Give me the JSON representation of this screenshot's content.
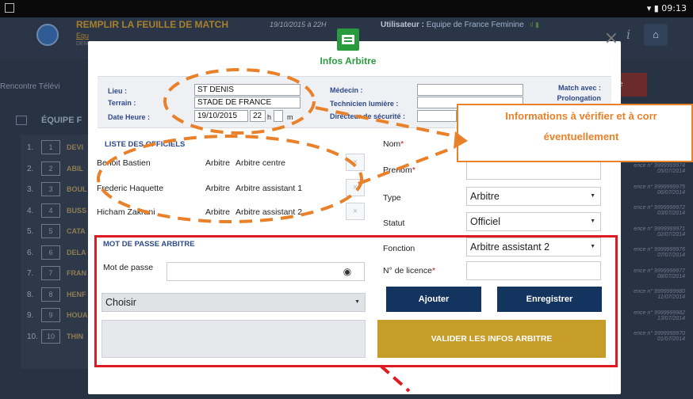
{
  "status_bar": {
    "time": "09:13"
  },
  "background_app": {
    "title": "REMPLIR LA FEUILLE DE MATCH",
    "sub1": "Equ",
    "sub2": "DEM",
    "date": "19/10/2015 à 22H",
    "user_label": "Utilisateur :",
    "user_value": "Equipe de France Feminine",
    "rencontre": "Rencontre Télévi",
    "red_button": "tre",
    "equipe_label": "ÉQUIPE F",
    "players": [
      {
        "n": "1.",
        "num": "1",
        "name": "DEVI"
      },
      {
        "n": "2.",
        "num": "2",
        "name": "ABIL"
      },
      {
        "n": "3.",
        "num": "3",
        "name": "BOUL"
      },
      {
        "n": "4.",
        "num": "4",
        "name": "BUSS"
      },
      {
        "n": "5.",
        "num": "5",
        "name": "CATA"
      },
      {
        "n": "6.",
        "num": "6",
        "name": "DELA"
      },
      {
        "n": "7.",
        "num": "7",
        "name": "FRAN"
      },
      {
        "n": "8.",
        "num": "8",
        "name": "HENF"
      },
      {
        "n": "9.",
        "num": "9",
        "name": "HOUA"
      },
      {
        "n": "10.",
        "num": "10",
        "name": "THIN"
      }
    ],
    "right_notes": [
      "ence n° 9999999974 05/07/2014",
      "ence n° 9999999975 06/07/2014",
      "ence n° 9999999972 03/07/2014",
      "ence n° 9999999971 02/07/2014",
      "ence n° 9999999976 07/07/2014",
      "ence n° 9999999977 08/07/2014",
      "ence n° 9999999980 11/07/2014",
      "ence n° 9999999982 13/07/2014",
      "ence n° 9999999970 01/07/2014"
    ]
  },
  "modal": {
    "title": "Infos Arbitre",
    "close": "×",
    "info": {
      "lieu_label": "Lieu :",
      "lieu_value": "ST DENIS",
      "terrain_label": "Terrain :",
      "terrain_value": "STADE DE FRANCE",
      "dateheure_label": "Date Heure :",
      "date_value": "19/10/2015",
      "hour_value": "22",
      "h_label": "h",
      "min_value": "",
      "m_label": "m",
      "medecin_label": "Médecin :",
      "technicien_label": "Technicien lumière :",
      "directeur_label": "Directeur de sécurité :",
      "match_avec_label": "Match avec :",
      "prolongation": "Prolongation"
    },
    "officials": {
      "title": "LISTE DES OFFICIELS",
      "rows": [
        {
          "name": "Benoit Bastien",
          "role": "Arbitre",
          "position": "Arbitre centre"
        },
        {
          "name": "Frederic Haquette",
          "role": "Arbitre",
          "position": "Arbitre assistant 1"
        },
        {
          "name": "Hicham Zakrani",
          "role": "Arbitre",
          "position": "Arbitre assistant 2"
        }
      ],
      "delete_glyph": "×"
    },
    "form": {
      "nom_label": "Nom",
      "prenom_label": "Prenom",
      "type_label": "Type",
      "type_value": "Arbitre",
      "statut_label": "Statut",
      "statut_value": "Officiel",
      "fonction_label": "Fonction",
      "fonction_value": "Arbitre assistant 2",
      "licence_label": "N° de licence",
      "required_mark": "*",
      "ajouter": "Ajouter",
      "enregistrer": "Enregistrer",
      "valider": "VALIDER LES INFOS ARBITRE"
    },
    "password": {
      "title": "MOT DE PASSE ARBITRE",
      "label": "Mot de passe",
      "select_value": "Choisir"
    }
  },
  "annotation": {
    "callout_line1": "Informations à vérifier et à corr",
    "callout_line2": "éventuellement",
    "orange": "#e9812a",
    "red": "#e01a22"
  }
}
